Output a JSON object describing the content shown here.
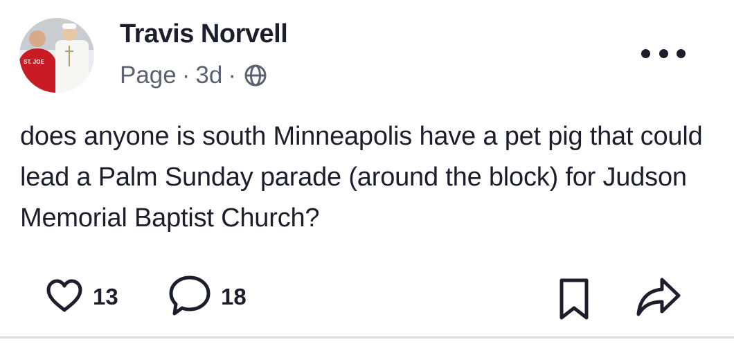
{
  "post": {
    "author": "Travis Norvell",
    "meta_type": "Page",
    "separator": "·",
    "age": "3d",
    "visibility_icon": "globe-icon",
    "text": "does anyone is south Minneapolis have a pet pig that could lead a Palm Sunday parade (around the block) for Judson Memorial Baptist Church?",
    "avatar_shirt_text": "ST. JOE"
  },
  "actions": {
    "like_count": "13",
    "comment_count": "18",
    "like_icon": "heart-icon",
    "comment_icon": "comment-bubble-icon",
    "bookmark_icon": "bookmark-icon",
    "share_icon": "share-arrow-icon",
    "more_icon": "more-dots-icon"
  },
  "colors": {
    "text_primary": "#1c1e2b",
    "text_secondary": "#5b6170",
    "divider": "#d9dce1",
    "background": "#ffffff"
  }
}
